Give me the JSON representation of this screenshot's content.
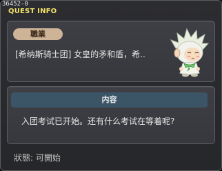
{
  "window": {
    "id_label": "36452-0",
    "title": "QUEST INFO"
  },
  "job_section": {
    "tag": "職業",
    "text": "[希纳斯骑士团] 女皇的矛和盾，希.."
  },
  "npc": {
    "icon": "npc-portrait-icon"
  },
  "content_section": {
    "header": "内容",
    "text": "入团考试已开始。还有什么考试在等着呢?"
  },
  "status": {
    "text": "狀態: 可開始"
  },
  "colors": {
    "title": "#f2e36a",
    "tag_bg": "#cdb497",
    "header_bg": "#3c5566"
  }
}
